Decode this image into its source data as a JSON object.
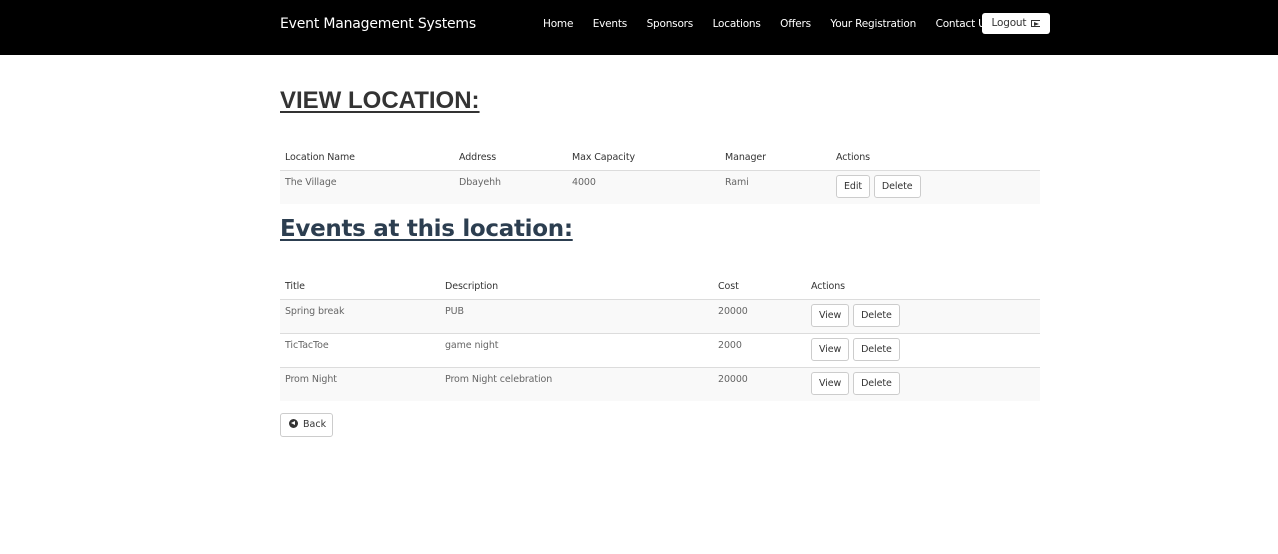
{
  "navbar": {
    "brand": "Event Management Systems",
    "links": [
      "Home",
      "Events",
      "Sponsors",
      "Locations",
      "Offers",
      "Your Registration",
      "Contact Us"
    ],
    "logout_label": "Logout",
    "logout_icon": "logout-icon"
  },
  "location": {
    "heading": "VIEW LOCATION:",
    "columns": [
      "Location Name",
      "Address",
      "Max Capacity",
      "Manager",
      "Actions"
    ],
    "row": {
      "name": "The Village",
      "address": "Dbayehh",
      "capacity": "4000",
      "manager": "Rami",
      "edit_label": "Edit",
      "delete_label": "Delete"
    }
  },
  "events": {
    "heading": "Events at this location:",
    "columns": [
      "Title",
      "Description",
      "Cost",
      "Actions"
    ],
    "rows": [
      {
        "title": "Spring break",
        "description": "PUB",
        "cost": "20000"
      },
      {
        "title": "TicTacToe",
        "description": "game night",
        "cost": "2000"
      },
      {
        "title": "Prom Night",
        "description": "Prom Night celebration",
        "cost": "20000"
      }
    ],
    "view_label": "View",
    "delete_label": "Delete"
  },
  "back": {
    "label": "Back",
    "icon": "arrow-circle-left-icon"
  }
}
